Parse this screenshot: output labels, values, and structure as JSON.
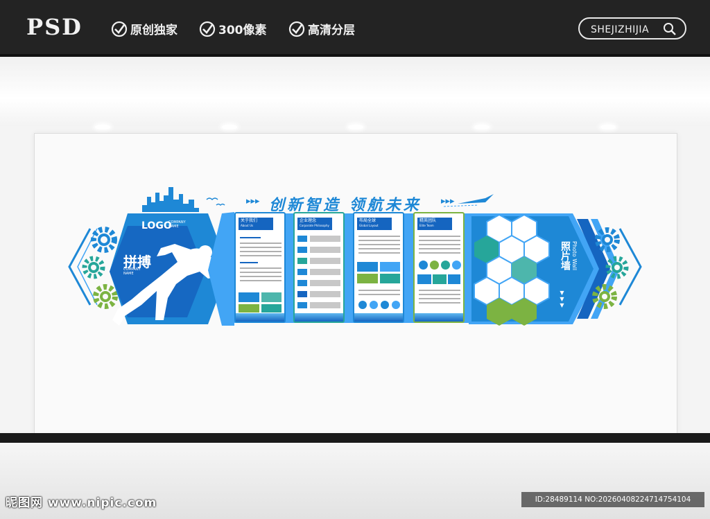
{
  "header": {
    "logo_text": "PSD",
    "badges": [
      "原创独家",
      "300像素",
      "高清分层"
    ],
    "search_label": "SHEJIZHIJIA"
  },
  "wall": {
    "slogan": "创新智造  领航未来",
    "slogan_arrows": "▸▸▸",
    "logo_label": "LOGO",
    "logo_company": "COMPANY NAME",
    "spirit_title": "拼搏",
    "spirit_company": "COMPANY NAME",
    "boards": [
      {
        "title": "关于我们",
        "subtitle": "About Us"
      },
      {
        "title": "企业理念",
        "subtitle": "Corporate Philosophy"
      },
      {
        "title": "布局全球",
        "subtitle": "Global Layout"
      },
      {
        "title": "精英团队",
        "subtitle": "Elite Team"
      }
    ],
    "photo_wall_title": "照片墙",
    "photo_wall_subtitle": "Photo Wall",
    "photo_wall_arrows": "▼▼▼"
  },
  "watermarks": {
    "left": "昵图网 www.nipic.com",
    "right": "ID:28489114 NO:20260408224714754104"
  },
  "colors": {
    "primary_blue": "#1e88d6",
    "dark_blue": "#1565c0",
    "light_blue": "#42a5f5",
    "green": "#7cb342",
    "teal": "#26a69a"
  }
}
